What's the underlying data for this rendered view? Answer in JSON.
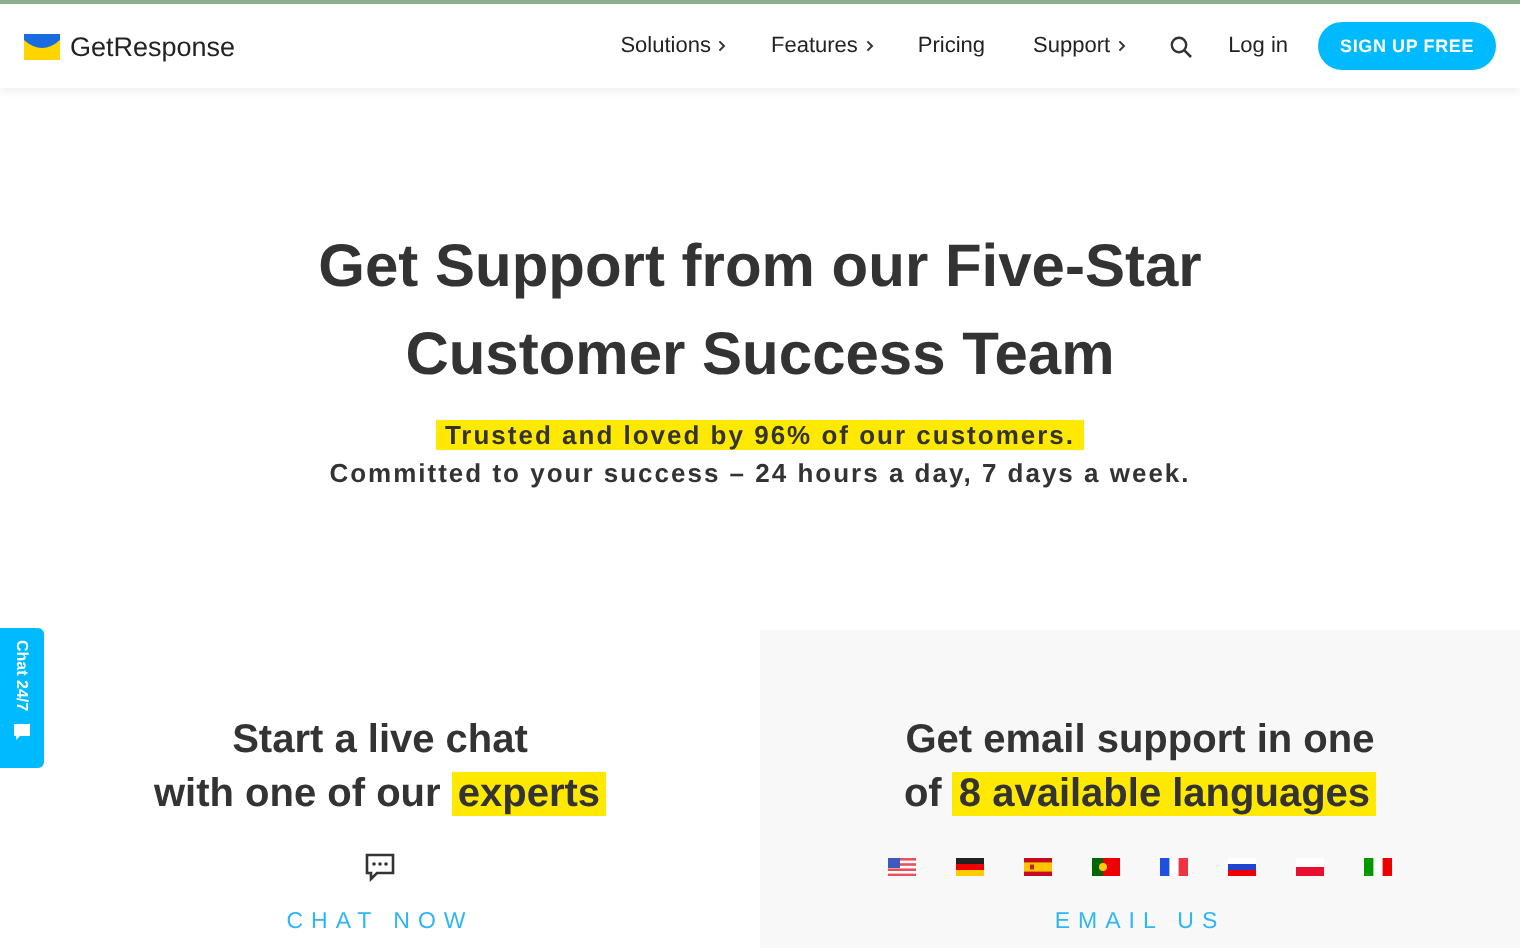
{
  "header": {
    "logo": "GetResponse",
    "nav": [
      {
        "label": "Solutions",
        "submenu": true
      },
      {
        "label": "Features",
        "submenu": true
      },
      {
        "label": "Pricing",
        "submenu": false
      },
      {
        "label": "Support",
        "submenu": true
      }
    ],
    "login": "Log in",
    "signup": "SIGN UP FREE"
  },
  "hero": {
    "title_lines": [
      "Get Support from our Five-Star",
      "Customer Success Team"
    ],
    "highlight": "Trusted and loved by 96% of our customers.",
    "subtitle": "Committed to your success – 24 hours a day, 7 days a week."
  },
  "chat_tab": {
    "label": "Chat 24/7"
  },
  "cards": [
    {
      "kind": "chat",
      "line1": "Start a live chat",
      "line2": "with one of our",
      "highlight": "experts",
      "link": "CHAT NOW"
    },
    {
      "kind": "email",
      "line1": "Get email support in one",
      "line2": "of",
      "highlight": "8 available languages",
      "link": "EMAIL US",
      "flags": [
        {
          "kind": "us"
        },
        {
          "kind": "de"
        },
        {
          "kind": "es"
        },
        {
          "kind": "pt"
        },
        {
          "kind": "fr"
        },
        {
          "kind": "ru"
        },
        {
          "kind": "pl"
        },
        {
          "kind": "it"
        }
      ]
    }
  ]
}
